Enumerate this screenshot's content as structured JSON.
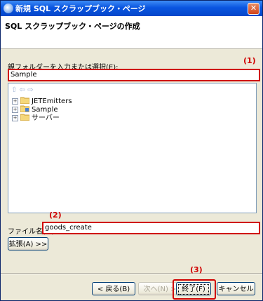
{
  "window": {
    "title": "新規 SQL スクラップブック・ページ",
    "close_glyph": "✕"
  },
  "header": {
    "title": "SQL スクラップブック・ページの作成"
  },
  "folder": {
    "label": "親フォルダーを入力または選択(E):",
    "value": "Sample"
  },
  "tree": {
    "toolbar_glyphs": "⇧ ⇦ ⇨",
    "items": [
      {
        "label": "JETEmitters",
        "expander": "+"
      },
      {
        "label": "Sample",
        "expander": "+"
      },
      {
        "label": "サーバー",
        "expander": "+"
      }
    ]
  },
  "filename": {
    "label": "ファイル名(M):",
    "value": "goods_create"
  },
  "buttons": {
    "expand": "拡張(A) >>",
    "back": "< 戻る(B)",
    "next": "次へ(N) >",
    "finish": "終了(F)",
    "cancel": "キャンセル"
  },
  "annotations": {
    "one": "(1)",
    "two": "(2)",
    "three": "(3)"
  },
  "colors": {
    "annotation": "#d00000",
    "titlebar": "#0a55e0"
  }
}
